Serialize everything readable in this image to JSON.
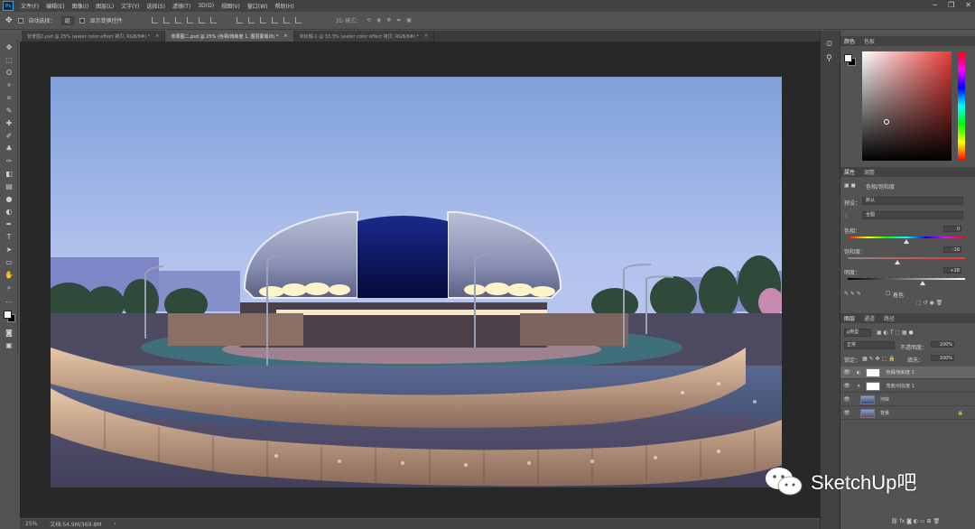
{
  "app": {
    "logo_text": "Ps"
  },
  "menu": [
    "文件(F)",
    "编辑(E)",
    "图像(I)",
    "图层(L)",
    "文字(Y)",
    "选择(S)",
    "滤镜(T)",
    "3D(D)",
    "视图(V)",
    "窗口(W)",
    "帮助(H)"
  ],
  "window_controls": [
    "minimize-icon",
    "restore-icon",
    "close-icon"
  ],
  "options": {
    "auto_select_label": "自动选择：",
    "auto_select_value": "组",
    "transform_label": "显示变换控件",
    "mode_3d_label": "3D 模式："
  },
  "tabs": [
    {
      "label": "背景图2.psd @ 25% (water color effect 拷贝, RGB/8#) *",
      "active": false
    },
    {
      "label": "效果图二.psd @ 25% (色相/饱和度 1, 图层蒙版/8) *",
      "active": true
    },
    {
      "label": "未标题-1 @ 33.3% (water color effect 拷贝, RGB/8#) *",
      "active": false
    }
  ],
  "tools": [
    "move-icon",
    "marquee-icon",
    "lasso-icon",
    "magic-wand-icon",
    "crop-icon",
    "eyedropper-icon",
    "healing-icon",
    "brush-icon",
    "stamp-icon",
    "history-brush-icon",
    "eraser-icon",
    "gradient-icon",
    "blur-icon",
    "dodge-icon",
    "pen-icon",
    "type-icon",
    "path-select-icon",
    "shape-icon",
    "hand-icon",
    "zoom-icon",
    "more-icon",
    "colors-icon",
    "quickmask-icon",
    "screenmode-icon"
  ],
  "status": {
    "zoom": "25%",
    "doc_size": "文档:54.9M/369.8M"
  },
  "color_panel": {
    "tabs": [
      "颜色",
      "色板"
    ],
    "accent": "#e83a36"
  },
  "properties_panel": {
    "tabs": [
      "属性",
      "调整"
    ],
    "title": "色相/饱和度",
    "preset_label": "预设：",
    "preset_value": "默认",
    "channel_value": "全图",
    "hue_label": "色相：",
    "hue_value": "0",
    "saturation_label": "饱和度：",
    "saturation_value": "-16",
    "lightness_label": "明度：",
    "lightness_value": "+28",
    "hue_fraction": 0.5,
    "saturation_fraction": 0.42,
    "lightness_fraction": 0.64,
    "colorize_label": "着色"
  },
  "layers_panel": {
    "tabs": [
      "图层",
      "通道",
      "路径"
    ],
    "filter_label": "ρ类型",
    "blend_mode": "正常",
    "opacity_label": "不透明度：",
    "opacity_value": "100%",
    "lock_label": "锁定：",
    "fill_label": "填充：",
    "fill_value": "100%",
    "layers": [
      {
        "name": "色相/饱和度 1",
        "selected": true
      },
      {
        "name": "亮度/对比度 1",
        "selected": false
      },
      {
        "name": "河岸",
        "selected": false
      },
      {
        "name": "背景",
        "selected": false,
        "locked": true
      }
    ]
  },
  "watermark": {
    "text": "SketchUp吧"
  }
}
